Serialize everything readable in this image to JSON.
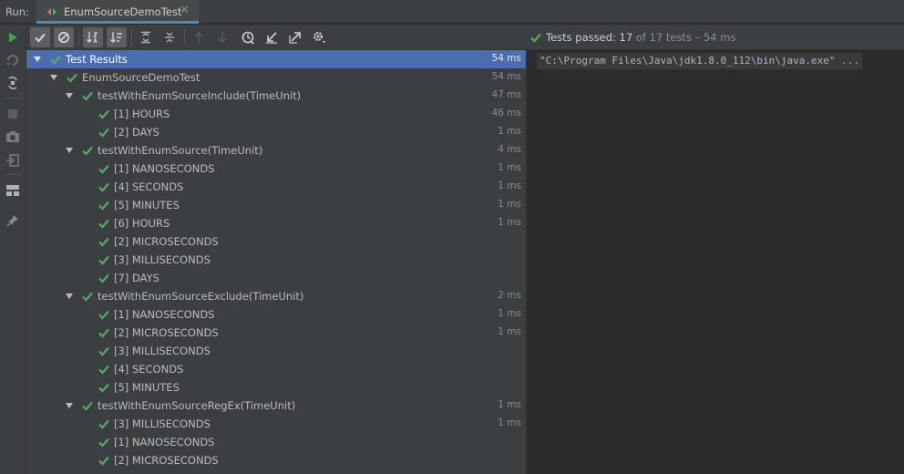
{
  "header": {
    "run_label": "Run:",
    "tab_title": "EnumSourceDemoTest",
    "tab_close": "✕"
  },
  "colors": {
    "pass_green": "#59a869",
    "selection_blue": "#4b6eaf",
    "tab_underline": "#4a88c7",
    "run_green": "#499c54"
  },
  "side_toolbar": {
    "items": [
      {
        "icon": "run-icon"
      },
      {
        "icon": "rerun-failed-icon"
      },
      {
        "icon": "toggle-auto-test-icon"
      },
      {
        "icon": "stop-icon"
      },
      {
        "icon": "camera-icon"
      },
      {
        "icon": "exit-icon"
      },
      {
        "icon": "layout-icon"
      },
      {
        "icon": "pin-icon"
      }
    ]
  },
  "tree_toolbar": {
    "items": [
      {
        "icon": "show-passed-icon",
        "pressed": true
      },
      {
        "icon": "show-ignored-icon",
        "pressed": true
      },
      {
        "icon": "sort-alphabetically-icon",
        "pressed": true
      },
      {
        "icon": "sort-by-duration-icon",
        "pressed": true
      },
      {
        "icon": "expand-all-icon",
        "pressed": false
      },
      {
        "icon": "collapse-all-icon",
        "pressed": false
      },
      {
        "icon": "previous-failed-icon",
        "pressed": false
      },
      {
        "icon": "next-failed-icon",
        "pressed": false
      },
      {
        "icon": "test-history-icon",
        "pressed": false
      },
      {
        "icon": "import-tests-icon",
        "pressed": false
      },
      {
        "icon": "export-tests-icon",
        "pressed": false
      },
      {
        "icon": "settings-icon",
        "pressed": false
      }
    ]
  },
  "status": {
    "prefix": "Tests passed: ",
    "passed": "17",
    "suffix": " of 17 tests – 54 ms"
  },
  "tree": {
    "rows": [
      {
        "level": 0,
        "expanded": true,
        "label": "Test Results",
        "time": "54 ms",
        "selected": true
      },
      {
        "level": 1,
        "expanded": true,
        "label": "EnumSourceDemoTest",
        "time": "54 ms"
      },
      {
        "level": 2,
        "expanded": true,
        "label": "testWithEnumSourceInclude(TimeUnit)",
        "time": "47 ms"
      },
      {
        "level": 3,
        "label": "[1] HOURS",
        "time": "46 ms"
      },
      {
        "level": 3,
        "label": "[2] DAYS",
        "time": "1 ms"
      },
      {
        "level": 2,
        "expanded": true,
        "label": "testWithEnumSource(TimeUnit)",
        "time": "4 ms"
      },
      {
        "level": 3,
        "label": "[1] NANOSECONDS",
        "time": "1 ms"
      },
      {
        "level": 3,
        "label": "[4] SECONDS",
        "time": "1 ms"
      },
      {
        "level": 3,
        "label": "[5] MINUTES",
        "time": "1 ms"
      },
      {
        "level": 3,
        "label": "[6] HOURS",
        "time": "1 ms"
      },
      {
        "level": 3,
        "label": "[2] MICROSECONDS",
        "time": ""
      },
      {
        "level": 3,
        "label": "[3] MILLISECONDS",
        "time": ""
      },
      {
        "level": 3,
        "label": "[7] DAYS",
        "time": ""
      },
      {
        "level": 2,
        "expanded": true,
        "label": "testWithEnumSourceExclude(TimeUnit)",
        "time": "2 ms"
      },
      {
        "level": 3,
        "label": "[1] NANOSECONDS",
        "time": "1 ms"
      },
      {
        "level": 3,
        "label": "[2] MICROSECONDS",
        "time": "1 ms"
      },
      {
        "level": 3,
        "label": "[3] MILLISECONDS",
        "time": ""
      },
      {
        "level": 3,
        "label": "[4] SECONDS",
        "time": ""
      },
      {
        "level": 3,
        "label": "[5] MINUTES",
        "time": ""
      },
      {
        "level": 2,
        "expanded": true,
        "label": "testWithEnumSourceRegEx(TimeUnit)",
        "time": "1 ms"
      },
      {
        "level": 3,
        "label": "[3] MILLISECONDS",
        "time": "1 ms"
      },
      {
        "level": 3,
        "label": "[1] NANOSECONDS",
        "time": ""
      },
      {
        "level": 3,
        "label": "[2] MICROSECONDS",
        "time": ""
      }
    ]
  },
  "console": {
    "line": "\"C:\\Program Files\\Java\\jdk1.8.0_112\\bin\\java.exe\" ..."
  }
}
